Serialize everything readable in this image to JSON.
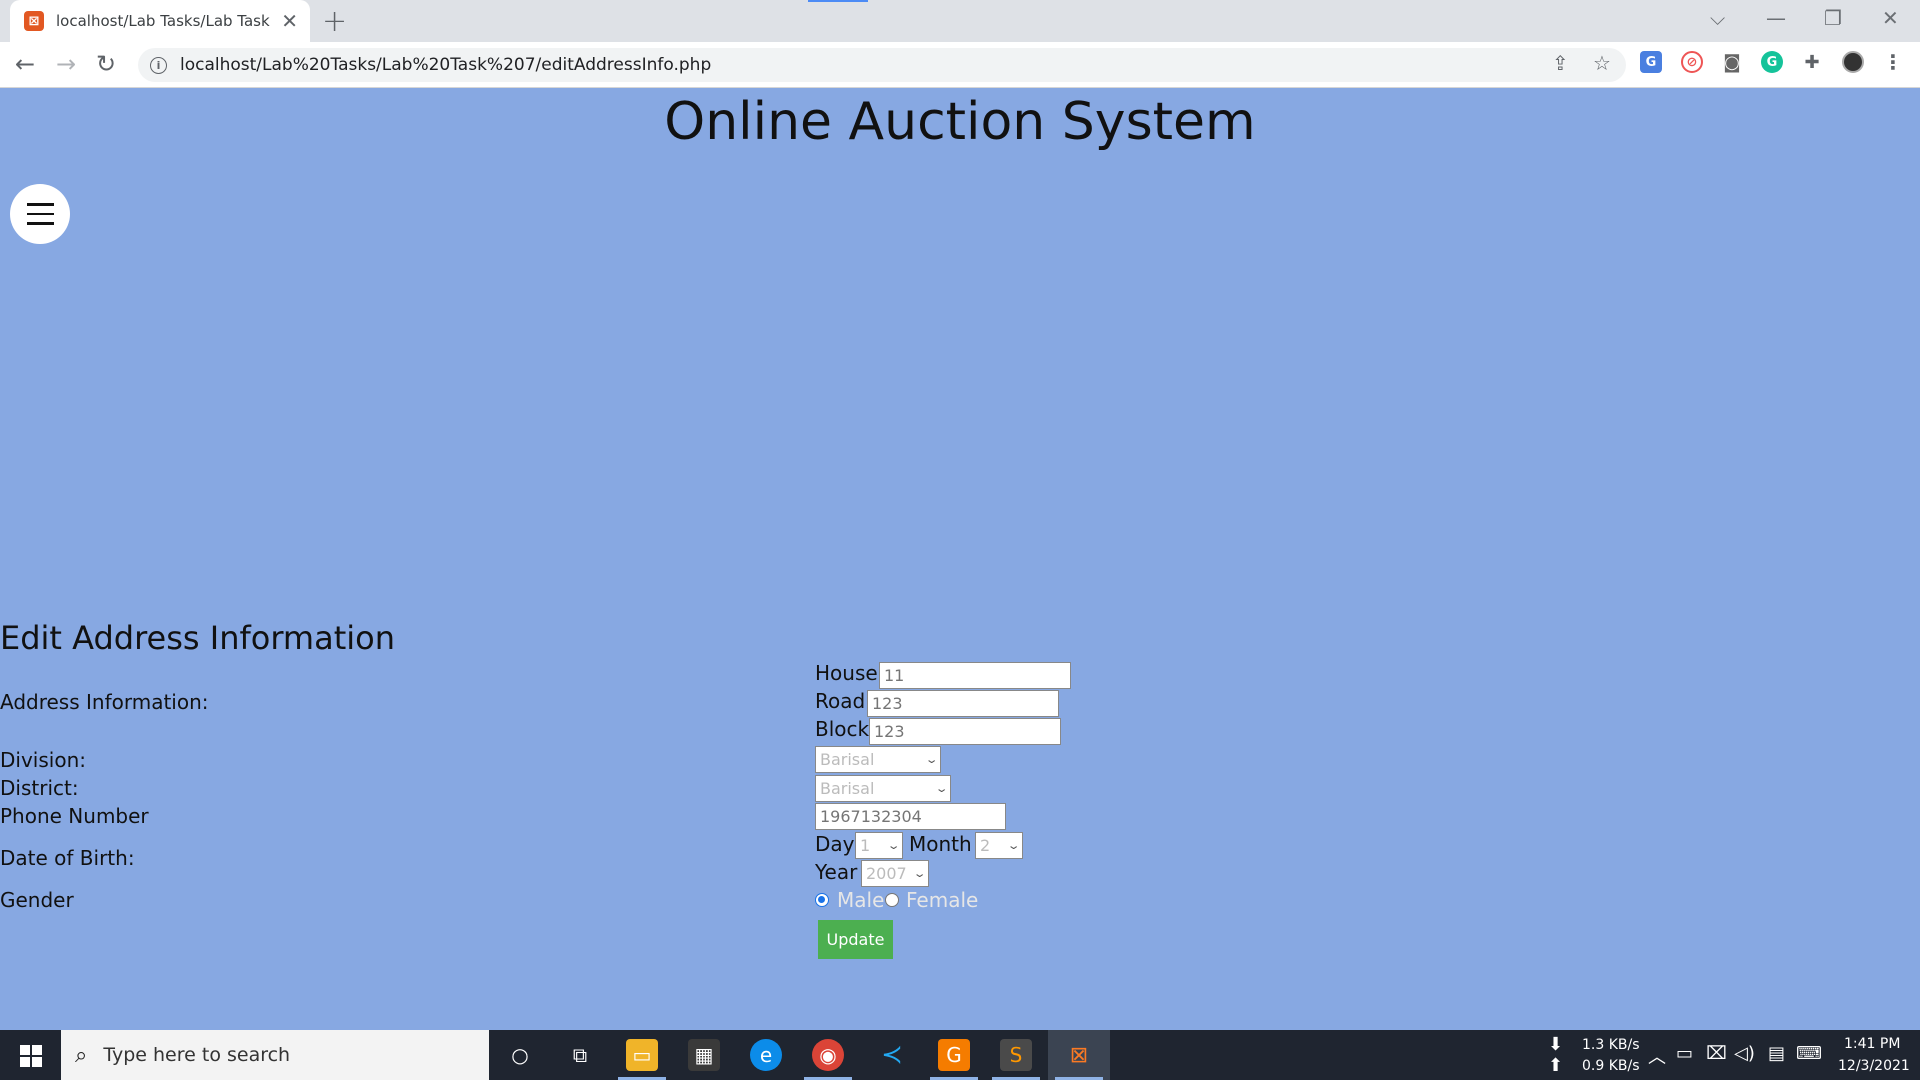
{
  "browser": {
    "tab_title": "localhost/Lab Tasks/Lab Task 7/e",
    "url": "localhost/Lab%20Tasks/Lab%20Task%207/editAddressInfo.php"
  },
  "page": {
    "site_title": "Online Auction System",
    "form_heading": "Edit Address Information",
    "labels": {
      "address": "Address Information:",
      "division": "Division:",
      "district": "District:",
      "phone": "Phone Number",
      "dob": "Date of Birth:",
      "gender": "Gender"
    },
    "address": {
      "house_label": "House",
      "house_placeholder": "11",
      "road_label": "Road",
      "road_placeholder": "123",
      "block_label": "Block",
      "block_placeholder": "123"
    },
    "division_value": "Barisal",
    "district_value": "Barisal",
    "phone_placeholder": "1967132304",
    "dob": {
      "day_label": "Day",
      "day_value": "1",
      "month_label": "Month",
      "month_value": "2",
      "year_label": "Year",
      "year_value": "2007"
    },
    "gender": {
      "male": "Male",
      "female": "Female",
      "selected": "Male"
    },
    "update_label": "Update"
  },
  "taskbar": {
    "search_placeholder": "Type here to search",
    "net_down": "1.3 KB/s",
    "net_up": "0.9 KB/s",
    "time": "1:41 PM",
    "date": "12/3/2021"
  }
}
